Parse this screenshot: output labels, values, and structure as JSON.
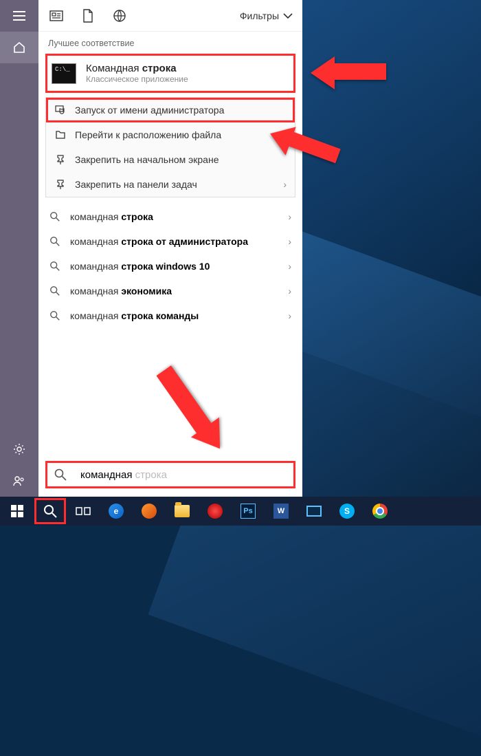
{
  "os": "windows-10",
  "language": "ru",
  "filters_label": "Фильтры",
  "best_match_header": "Лучшее соответствие",
  "best_match": {
    "title_prefix": "Командная",
    "title_bold": "строка",
    "subtitle": "Классическое приложение",
    "cmd_prompt": "C:\\_"
  },
  "context_items": [
    {
      "icon": "shield-computer-icon",
      "label": "Запуск от имени администратора",
      "highlight": true,
      "chevron": false
    },
    {
      "icon": "folder-location-icon",
      "label": "Перейти к расположению файла",
      "highlight": false,
      "chevron": false
    },
    {
      "icon": "pin-start-icon",
      "label": "Закрепить на начальном экране",
      "highlight": false,
      "chevron": false
    },
    {
      "icon": "pin-taskbar-icon",
      "label": "Закрепить на панели задач",
      "highlight": false,
      "chevron": true
    }
  ],
  "suggestions": [
    {
      "pre": "командная ",
      "bold": "строка",
      "post": ""
    },
    {
      "pre": "командная ",
      "bold": "строка от администратора",
      "post": ""
    },
    {
      "pre": "командная ",
      "bold": "строка windows 10",
      "post": ""
    },
    {
      "pre": "командная ",
      "bold": "экономика",
      "post": ""
    },
    {
      "pre": "командная ",
      "bold": "строка команды",
      "post": ""
    }
  ],
  "search": {
    "typed": "командная",
    "ghost": " строка"
  },
  "rail": {
    "top": [
      "hamburger-icon",
      "home-icon"
    ],
    "bottom": [
      "gear-icon",
      "people-icon"
    ]
  },
  "taskbar": [
    {
      "icon": "windows-start-icon",
      "hl": false
    },
    {
      "icon": "search-icon",
      "hl": true
    },
    {
      "icon": "task-view-icon",
      "hl": false
    },
    {
      "icon": "edge-icon",
      "hl": false
    },
    {
      "icon": "firefox-icon",
      "hl": false
    },
    {
      "icon": "file-explorer-icon",
      "hl": false
    },
    {
      "icon": "opera-icon",
      "hl": false
    },
    {
      "icon": "photoshop-icon",
      "hl": false
    },
    {
      "icon": "word-icon",
      "hl": false
    },
    {
      "icon": "display-icon",
      "hl": false
    },
    {
      "icon": "skype-icon",
      "hl": false
    },
    {
      "icon": "chrome-icon",
      "hl": false
    }
  ]
}
